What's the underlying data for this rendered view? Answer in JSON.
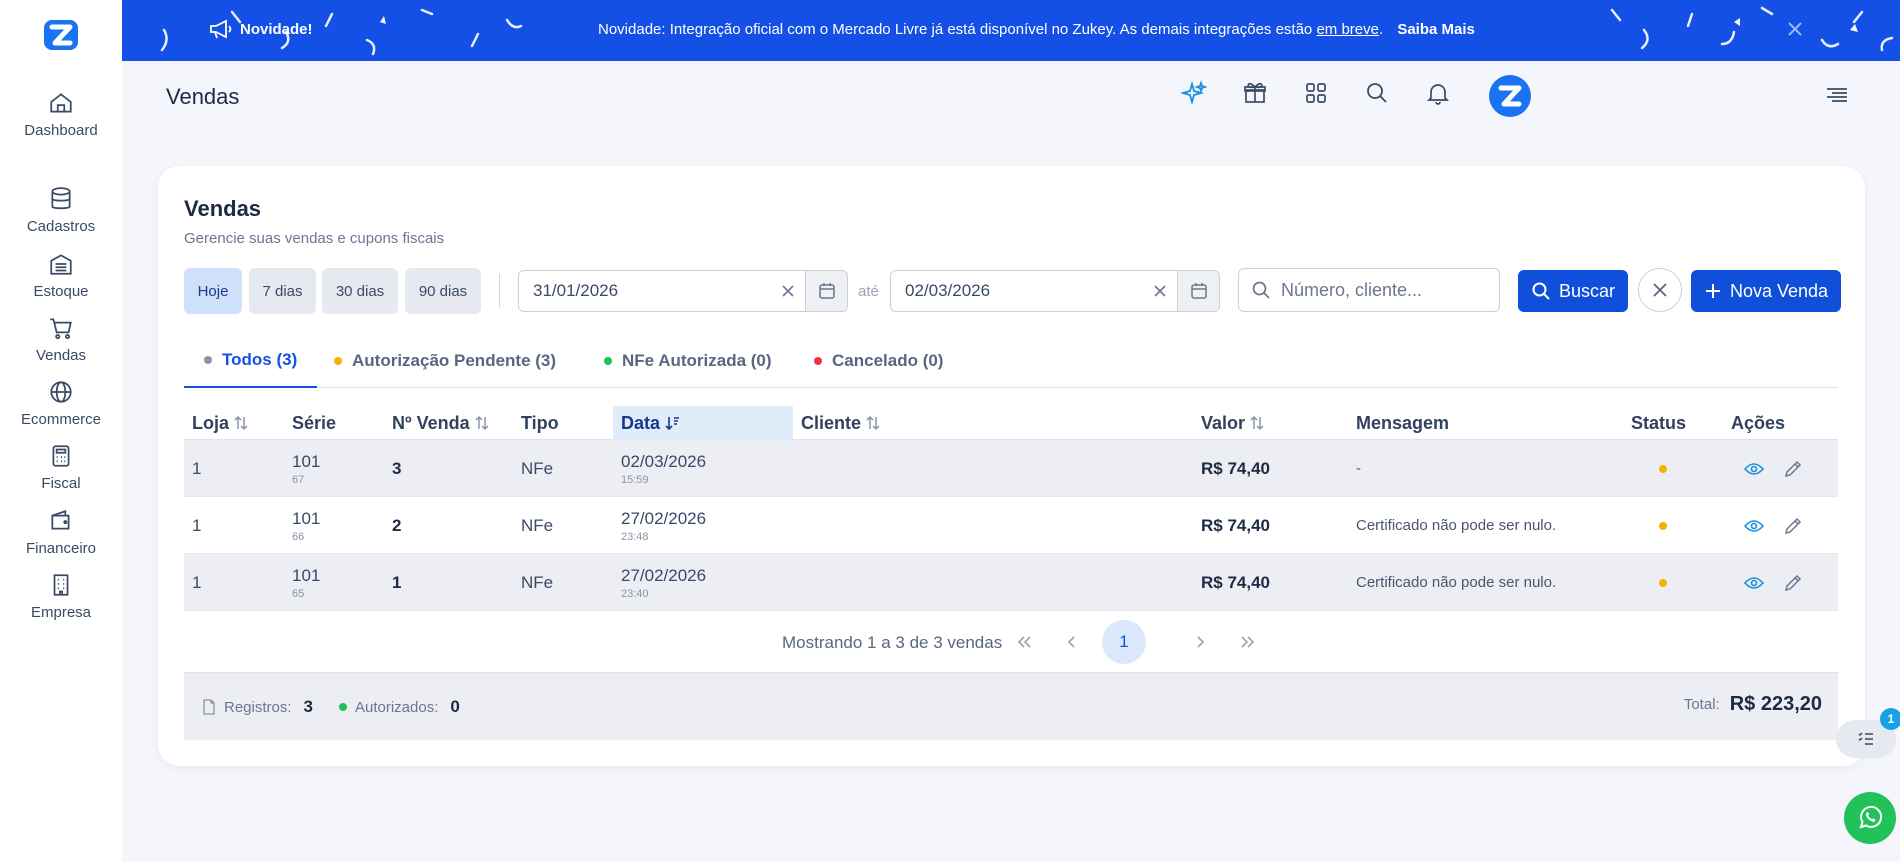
{
  "banner": {
    "badge": "Novidade!",
    "message": "Novidade: Integração oficial com o Mercado Livre já está disponível no Zukey. As demais integrações estão",
    "link": "em breve",
    "punct": ".",
    "more": "Saiba Mais"
  },
  "sidebar": {
    "items": [
      {
        "label": "Dashboard",
        "icon": "home-icon"
      },
      {
        "label": "Cadastros",
        "icon": "database-icon"
      },
      {
        "label": "Estoque",
        "icon": "warehouse-icon"
      },
      {
        "label": "Vendas",
        "icon": "cart-icon"
      },
      {
        "label": "Ecommerce",
        "icon": "globe-icon"
      },
      {
        "label": "Fiscal",
        "icon": "calculator-icon"
      },
      {
        "label": "Financeiro",
        "icon": "wallet-icon"
      },
      {
        "label": "Empresa",
        "icon": "building-icon"
      }
    ]
  },
  "header": {
    "title": "Vendas"
  },
  "card": {
    "title": "Vendas",
    "subtitle": "Gerencie suas vendas e cupons fiscais"
  },
  "filters": {
    "periods": [
      "Hoje",
      "7 dias",
      "30 dias",
      "90 dias"
    ],
    "date_from": "31/01/2026",
    "date_sep": "até",
    "date_to": "02/03/2026",
    "search_placeholder": "Número, cliente...",
    "search_button": "Buscar",
    "new_button": "Nova Venda"
  },
  "tabs": [
    {
      "label": "Todos (3)",
      "color": "#8a93a6"
    },
    {
      "label": "Autorização Pendente (3)",
      "color": "#f0b400"
    },
    {
      "label": "NFe Autorizada (0)",
      "color": "#21c25a"
    },
    {
      "label": "Cancelado (0)",
      "color": "#ef3340"
    }
  ],
  "table": {
    "headers": {
      "loja": "Loja",
      "serie": "Série",
      "numero": "Nº Venda",
      "tipo": "Tipo",
      "data": "Data",
      "cliente": "Cliente",
      "valor": "Valor",
      "mensagem": "Mensagem",
      "status": "Status",
      "acoes": "Ações"
    },
    "rows": [
      {
        "loja": "1",
        "serie": "101",
        "serie_sub": "67",
        "numero": "3",
        "tipo": "NFe",
        "data": "02/03/2026",
        "hora": "15:59",
        "cliente": "",
        "valor": "R$ 74,40",
        "mensagem": "-"
      },
      {
        "loja": "1",
        "serie": "101",
        "serie_sub": "66",
        "numero": "2",
        "tipo": "NFe",
        "data": "27/02/2026",
        "hora": "23:48",
        "cliente": "",
        "valor": "R$ 74,40",
        "mensagem": "Certificado não pode ser nulo."
      },
      {
        "loja": "1",
        "serie": "101",
        "serie_sub": "65",
        "numero": "1",
        "tipo": "NFe",
        "data": "27/02/2026",
        "hora": "23:40",
        "cliente": "",
        "valor": "R$ 74,40",
        "mensagem": "Certificado não pode ser nulo."
      }
    ]
  },
  "pager": {
    "info": "Mostrando 1 a 3 de 3 vendas",
    "current": "1"
  },
  "footer": {
    "registros_label": "Registros:",
    "registros_value": "3",
    "autorizados_label": "Autorizados:",
    "autorizados_value": "0",
    "total_label": "Total:",
    "total_value": "R$ 223,20"
  },
  "floating": {
    "badge": "1"
  },
  "colors": {
    "primary": "#1450e6",
    "pending": "#f0b400",
    "authorized": "#21c25a",
    "cancelled": "#ef3340"
  }
}
